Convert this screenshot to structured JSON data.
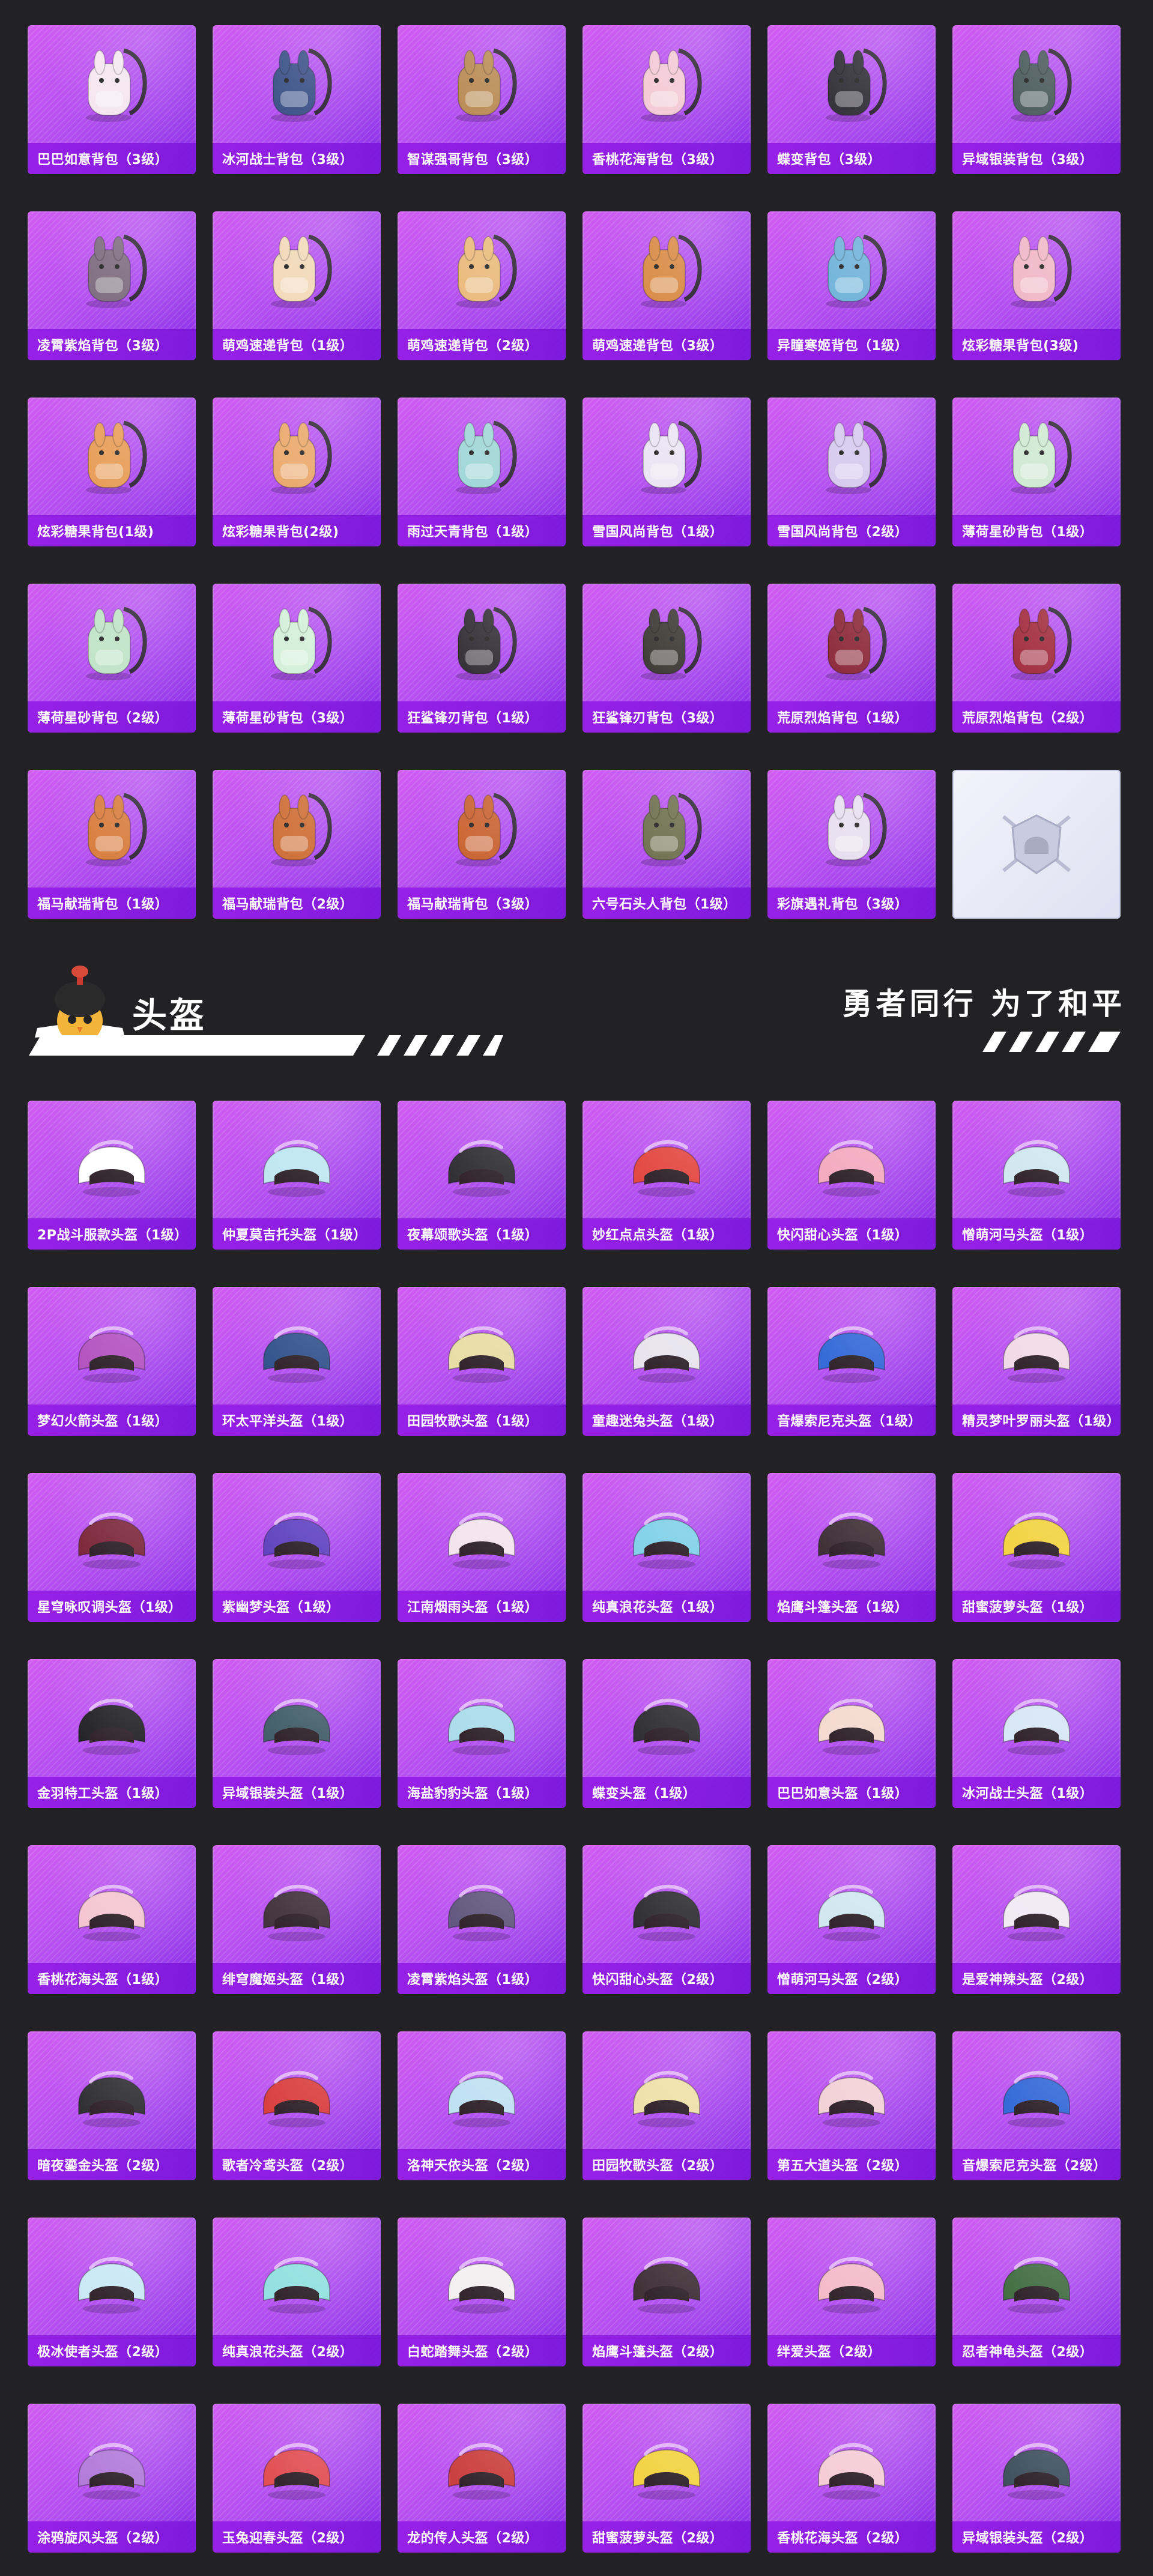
{
  "bags": [
    {
      "label": "巴巴如意背包（3级）",
      "icon": "bunny-backpack-icon",
      "color": "#f4e6ef"
    },
    {
      "label": "冰河战士背包（3级）",
      "icon": "armored-backpack-icon",
      "color": "#3a4f86"
    },
    {
      "label": "智谋强哥背包（3级）",
      "icon": "animal-backpack-icon",
      "color": "#b98a53"
    },
    {
      "label": "香桃花海背包（3级）",
      "icon": "flower-backpack-icon",
      "color": "#f3c9d6"
    },
    {
      "label": "蝶变背包（3级）",
      "icon": "tech-backpack-icon",
      "color": "#2e2c36"
    },
    {
      "label": "异域银装背包（3级）",
      "icon": "tech-backpack-icon",
      "color": "#4a5a5c"
    },
    {
      "label": "凌霄紫焰背包（3级）",
      "icon": "ornate-backpack-icon",
      "color": "#7c6a7d"
    },
    {
      "label": "萌鸡速递背包（1级）",
      "icon": "chick-backpack-icon",
      "color": "#f2d9b8"
    },
    {
      "label": "萌鸡速递背包（2级）",
      "icon": "chick-backpack-icon",
      "color": "#e9b97b"
    },
    {
      "label": "萌鸡速递背包（3级）",
      "icon": "chick-backpack-icon",
      "color": "#d88a44"
    },
    {
      "label": "异瞳寒姬背包（1级）",
      "icon": "doll-backpack-icon",
      "color": "#6fb2d9"
    },
    {
      "label": "炫彩糖果背包(3级)",
      "icon": "donut-backpack-icon",
      "color": "#f0b6c8"
    },
    {
      "label": "炫彩糖果背包(1级)",
      "icon": "donut-backpack-icon",
      "color": "#e79b54"
    },
    {
      "label": "炫彩糖果背包(2级)",
      "icon": "donut-backpack-icon",
      "color": "#eaa86a"
    },
    {
      "label": "雨过天青背包（1级）",
      "icon": "small-pouch-icon",
      "color": "#9fd6d6"
    },
    {
      "label": "雪国风尚背包（1级）",
      "icon": "snow-backpack-icon",
      "color": "#e9e4f3"
    },
    {
      "label": "雪国风尚背包（2级）",
      "icon": "snow-backpack-icon",
      "color": "#d6c9ee"
    },
    {
      "label": "薄荷星砂背包（1级）",
      "icon": "mint-backpack-icon",
      "color": "#cfe9d2"
    },
    {
      "label": "薄荷星砂背包（2级）",
      "icon": "mint-backpack-icon",
      "color": "#bfe3c6"
    },
    {
      "label": "薄荷星砂背包（3级）",
      "icon": "mint-backpack-icon",
      "color": "#d2f0d8"
    },
    {
      "label": "狂鲨锋刃背包（1级）",
      "icon": "shark-backpack-icon",
      "color": "#2e2c32"
    },
    {
      "label": "狂鲨锋刃背包（3级）",
      "icon": "shark-backpack-icon",
      "color": "#3a3632"
    },
    {
      "label": "荒原烈焰背包（1级）",
      "icon": "flame-backpack-icon",
      "color": "#8a2536"
    },
    {
      "label": "荒原烈焰背包（2级）",
      "icon": "flame-backpack-icon",
      "color": "#a02a3c"
    },
    {
      "label": "福马献瑞背包（1级）",
      "icon": "horse-backpack-icon",
      "color": "#d77a3a"
    },
    {
      "label": "福马献瑞背包（2级）",
      "icon": "horse-backpack-icon",
      "color": "#cd6c33"
    },
    {
      "label": "福马献瑞背包（3级）",
      "icon": "horse-backpack-icon",
      "color": "#c8602e"
    },
    {
      "label": "六号石头人背包（1级）",
      "icon": "stone-backpack-icon",
      "color": "#6e6f4e"
    },
    {
      "label": "彩旗遇礼背包（3级）",
      "icon": "gift-backpack-icon",
      "color": "#e7dfef"
    }
  ],
  "placeholder_icon": "emblem-icon",
  "section": {
    "title": "头盔",
    "slogan": "勇者同行 为了和平",
    "mascot_icon": "mascot-chick-icon",
    "accent": "#ffffff"
  },
  "helmets": [
    {
      "label": "2P战斗服款头盔（1级）",
      "icon": "helmet-icon",
      "color": "#ffffff"
    },
    {
      "label": "仲夏莫吉托头盔（1级）",
      "icon": "helmet-icon",
      "color": "#bde6f2"
    },
    {
      "label": "夜幕颂歌头盔（1级）",
      "icon": "helmet-icon",
      "color": "#2b2a2e"
    },
    {
      "label": "妙红点点头盔（1级）",
      "icon": "helmet-icon",
      "color": "#e2433d"
    },
    {
      "label": "快闪甜心头盔（1级）",
      "icon": "helmet-icon",
      "color": "#f3a8c0"
    },
    {
      "label": "憎萌河马头盔（1级）",
      "icon": "helmet-icon",
      "color": "#cfe7f0"
    },
    {
      "label": "梦幻火箭头盔（1级）",
      "icon": "helmet-icon",
      "color": "#b24fbf"
    },
    {
      "label": "环太平洋头盔（1级）",
      "icon": "helmet-icon",
      "color": "#2d4f8a"
    },
    {
      "label": "田园牧歌头盔（1级）",
      "icon": "helmet-icon",
      "color": "#e8dca3"
    },
    {
      "label": "童趣迷兔头盔（1级）",
      "icon": "helmet-icon",
      "color": "#e6e3ee"
    },
    {
      "label": "音爆索尼克头盔（1级）",
      "icon": "helmet-icon",
      "color": "#2f66d6"
    },
    {
      "label": "精灵梦叶罗丽头盔（1级）",
      "icon": "helmet-icon",
      "color": "#f1d9e6"
    },
    {
      "label": "星穹咏叹调头盔（1级）",
      "icon": "helmet-icon",
      "color": "#7a2437"
    },
    {
      "label": "紫幽梦头盔（1级）",
      "icon": "helmet-icon",
      "color": "#5e3fbf"
    },
    {
      "label": "江南烟雨头盔（1级）",
      "icon": "helmet-icon",
      "color": "#f2e3ec"
    },
    {
      "label": "纯真浪花头盔（1级）",
      "icon": "helmet-icon",
      "color": "#7fd0e8"
    },
    {
      "label": "焰鹰斗篷头盔（1级）",
      "icon": "helmet-icon",
      "color": "#3a2b31"
    },
    {
      "label": "甜蜜菠萝头盔（1级）",
      "icon": "helmet-icon",
      "color": "#f2d23e"
    },
    {
      "label": "金羽特工头盔（1级）",
      "icon": "helmet-icon",
      "color": "#1f1e22"
    },
    {
      "label": "异域银装头盔（1级）",
      "icon": "helmet-icon",
      "color": "#3e5a66"
    },
    {
      "label": "海盐豹豹头盔（1级）",
      "icon": "helmet-icon",
      "color": "#a9dbea"
    },
    {
      "label": "蝶变头盔（1级）",
      "icon": "helmet-icon",
      "color": "#2b2a2e"
    },
    {
      "label": "巴巴如意头盔（1级）",
      "icon": "helmet-icon",
      "color": "#f4d9cf"
    },
    {
      "label": "冰河战士头盔（1级）",
      "icon": "helmet-icon",
      "color": "#d7e6f5"
    },
    {
      "label": "香桃花海头盔（1级）",
      "icon": "helmet-icon",
      "color": "#f4c4d2"
    },
    {
      "label": "绯穹魔姬头盔（1级）",
      "icon": "helmet-icon",
      "color": "#3d2e37"
    },
    {
      "label": "凌霄紫焰头盔（1级）",
      "icon": "helmet-icon",
      "color": "#5e547c"
    },
    {
      "label": "快闪甜心头盔（2级）",
      "icon": "helmet-icon",
      "color": "#2b2a2e"
    },
    {
      "label": "憎萌河马头盔（2级）",
      "icon": "helmet-icon",
      "color": "#cfe7f0"
    },
    {
      "label": "是爱神辣头盔（2级）",
      "icon": "helmet-icon",
      "color": "#f1e9f5"
    },
    {
      "label": "暗夜鎏金头盔（2级）",
      "icon": "helmet-icon",
      "color": "#2b2a2e"
    },
    {
      "label": "歌者冷鸢头盔（2级）",
      "icon": "helmet-icon",
      "color": "#d83a3a"
    },
    {
      "label": "洛神天依头盔（2级）",
      "icon": "helmet-icon",
      "color": "#bde0f2"
    },
    {
      "label": "田园牧歌头盔（2级）",
      "icon": "helmet-icon",
      "color": "#eee0a8"
    },
    {
      "label": "第五大道头盔（2级）",
      "icon": "helmet-icon",
      "color": "#f2d0d6"
    },
    {
      "label": "音爆索尼克头盔（2级）",
      "icon": "helmet-icon",
      "color": "#2f66d6"
    },
    {
      "label": "极冰使者头盔（2级）",
      "icon": "helmet-icon",
      "color": "#c8e7f5"
    },
    {
      "label": "纯真浪花头盔（2级）",
      "icon": "helmet-icon",
      "color": "#8fdfe0"
    },
    {
      "label": "白蛇踏舞头盔（2级）",
      "icon": "helmet-icon",
      "color": "#f3eef0"
    },
    {
      "label": "焰鹰斗篷头盔（2级）",
      "icon": "helmet-icon",
      "color": "#3a2b31"
    },
    {
      "label": "绊爱头盔（2级）",
      "icon": "helmet-icon",
      "color": "#f4b9c9"
    },
    {
      "label": "忍者神龟头盔（2级）",
      "icon": "helmet-icon",
      "color": "#3e6b3f"
    },
    {
      "label": "涂鸦旋风头盔（2级）",
      "icon": "helmet-icon",
      "color": "#b078d8"
    },
    {
      "label": "玉兔迎春头盔（2级）",
      "icon": "helmet-icon",
      "color": "#e04a4f"
    },
    {
      "label": "龙的传人头盔（2级）",
      "icon": "helmet-icon",
      "color": "#c93a3a"
    },
    {
      "label": "甜蜜菠萝头盔（2级）",
      "icon": "helmet-icon",
      "color": "#f2d23e"
    },
    {
      "label": "香桃花海头盔（2级）",
      "icon": "helmet-icon",
      "color": "#f4cbd6"
    },
    {
      "label": "异域银装头盔（2级）",
      "icon": "helmet-icon",
      "color": "#3b4c5a"
    }
  ]
}
